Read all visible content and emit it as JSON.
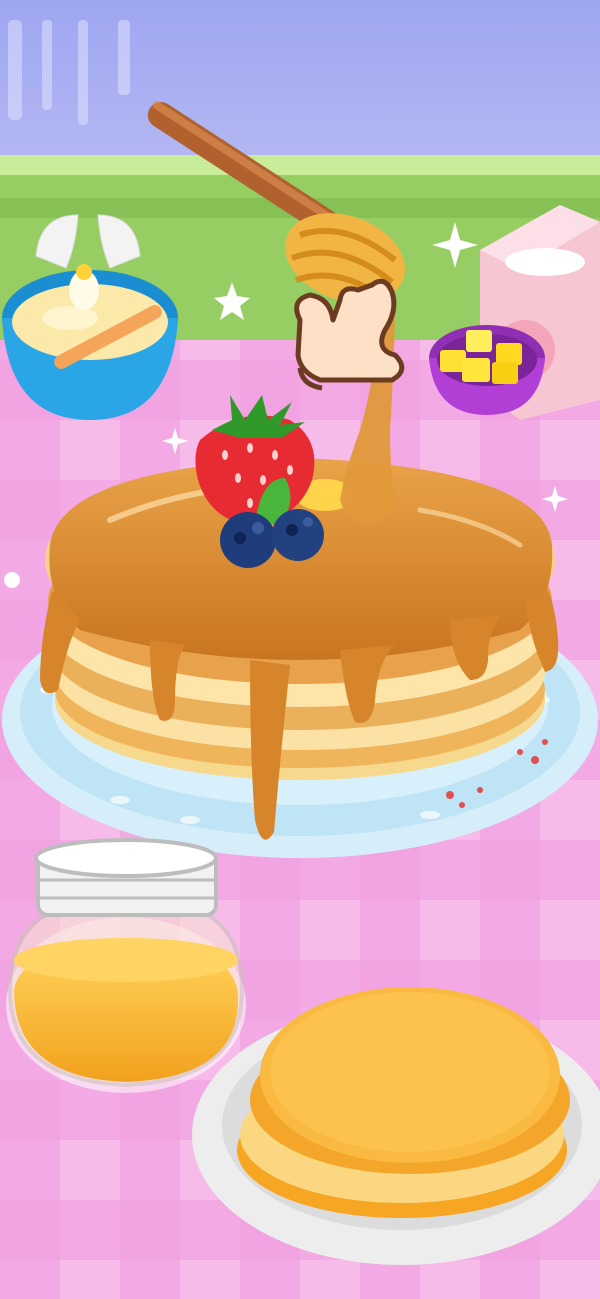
{
  "game": {
    "scene": "pancake-decorating",
    "tutorial_hint": "tap-hand",
    "items": {
      "egg_bowl": "egg-batter-bowl",
      "flour_box": "flour-box",
      "butter_bowl": "butter-cubes-bowl",
      "honey_jar": "honey-jar",
      "honey_dipper": "honey-dipper",
      "pancake_stack": "decorated-pancake-stack",
      "plain_pancakes": "plain-pancakes-plate"
    },
    "toppings": [
      "strawberry",
      "blueberry",
      "blueberry",
      "mint-leaf",
      "butter-pat",
      "honey-syrup"
    ]
  },
  "colors": {
    "wall": "#a9aef0",
    "counter_green": "#9ed36a",
    "table_pink": "#f6b2e6",
    "table_stripe": "#ee8fda",
    "syrup": "#d98a2e",
    "pancake": "#f7c561",
    "bowl_blue": "#2aa6e6",
    "bowl_purple": "#b13fd6"
  }
}
